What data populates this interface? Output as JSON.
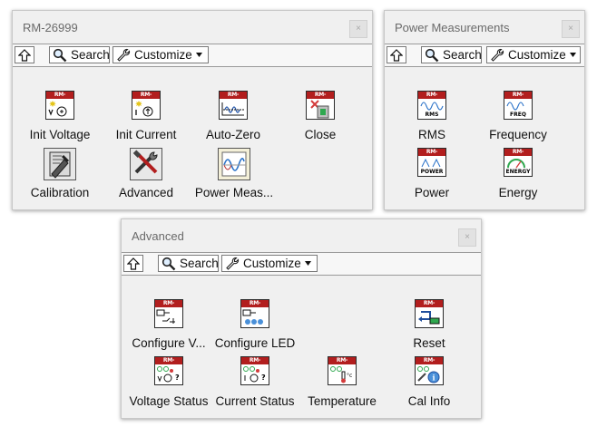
{
  "rm_palette": {
    "title": "RM-26999",
    "close_glyph": "×",
    "toolbar": {
      "up_icon": "up-arrow-icon",
      "search_label": "Search",
      "customize_label": "Customize"
    },
    "items": [
      {
        "label": "Init Voltage",
        "header": "RM-26999",
        "icon": "init-voltage-icon"
      },
      {
        "label": "Init Current",
        "header": "RM-26999",
        "icon": "init-current-icon"
      },
      {
        "label": "Auto-Zero",
        "header": "RM-26999",
        "icon": "auto-zero-icon"
      },
      {
        "label": "Close",
        "header": "RM-26999",
        "icon": "close-session-icon"
      },
      {
        "label": "Calibration",
        "icon": "calibration-folder-icon"
      },
      {
        "label": "Advanced",
        "icon": "advanced-folder-icon"
      },
      {
        "label": "Power Meas...",
        "icon": "power-measurements-folder-icon"
      }
    ]
  },
  "power_palette": {
    "title": "Power Measurements",
    "close_glyph": "×",
    "toolbar": {
      "up_icon": "up-arrow-icon",
      "search_label": "Search",
      "customize_label": "Customize"
    },
    "items": [
      {
        "label": "RMS",
        "header": "RM-26999",
        "icon_text": "RMS"
      },
      {
        "label": "Frequency",
        "header": "RM-26999",
        "icon_text": "FREQ"
      },
      {
        "label": "Power",
        "header": "RM-26999",
        "icon_text": "POWER"
      },
      {
        "label": "Energy",
        "header": "RM-26999",
        "icon_text": "ENERGY"
      }
    ]
  },
  "advanced_palette": {
    "title": "Advanced",
    "close_glyph": "×",
    "toolbar": {
      "up_icon": "up-arrow-icon",
      "search_label": "Search",
      "customize_label": "Customize"
    },
    "items": [
      {
        "label": "Configure V...",
        "header": "RM-26999",
        "icon": "configure-voltage-icon"
      },
      {
        "label": "Configure LED",
        "header": "RM-26999",
        "icon": "configure-led-icon"
      },
      {
        "label": "Reset",
        "header": "RM-26999",
        "icon": "reset-icon"
      },
      {
        "label": "Voltage Status",
        "header": "RM-26999",
        "icon": "voltage-status-icon"
      },
      {
        "label": "Current Status",
        "header": "RM-26999",
        "icon": "current-status-icon"
      },
      {
        "label": "Temperature",
        "header": "RM-26999",
        "icon": "temperature-icon"
      },
      {
        "label": "Cal Info",
        "header": "RM-26999",
        "icon": "cal-info-icon"
      }
    ]
  }
}
